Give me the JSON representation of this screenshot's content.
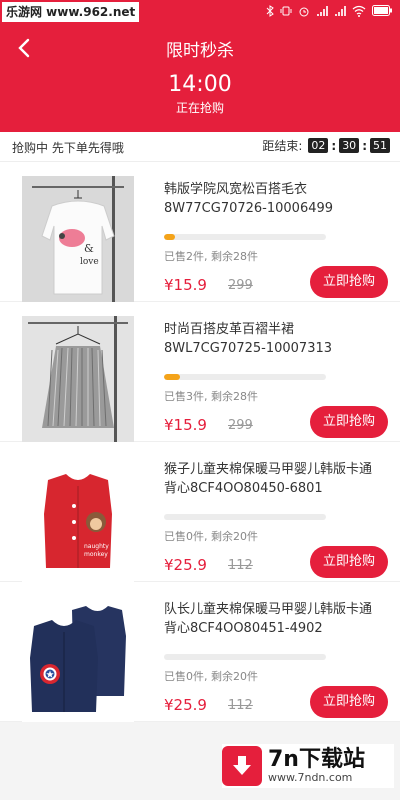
{
  "statusbar": {
    "watermark": "乐游网 www.962.net",
    "icons": [
      "bluetooth-icon",
      "vibrate-icon",
      "alarm-icon",
      "signal-icon",
      "signal-icon",
      "wifi-icon",
      "battery-icon"
    ]
  },
  "header": {
    "title": "限时秒杀",
    "time": "14:00",
    "status": "正在抢购",
    "bg_color": "#e51f3c"
  },
  "infobar": {
    "left_text": "抢购中 先下单先得哦",
    "countdown_label": "距结束:",
    "hours": "02",
    "minutes": "30",
    "seconds": "51"
  },
  "products": [
    {
      "name": "韩版学院风宽松百搭毛衣8W77CG70726-10006499",
      "sold_text": "已售2件, 剩余28件",
      "progress": 0.07,
      "price": "¥15.9",
      "old_price": "299",
      "button": "立即抢购",
      "image": "white-sweater-image"
    },
    {
      "name": "时尚百搭皮革百褶半裙8WL7CG70725-10007313",
      "sold_text": "已售3件, 剩余28件",
      "progress": 0.1,
      "price": "¥15.9",
      "old_price": "299",
      "button": "立即抢购",
      "image": "pleated-skirt-image"
    },
    {
      "name": "猴子儿童夹棉保暖马甲婴儿韩版卡通背心8CF4OO80450-6801",
      "sold_text": "已售0件, 剩余20件",
      "progress": 0,
      "price": "¥25.9",
      "old_price": "112",
      "button": "立即抢购",
      "image": "red-kids-vest-image"
    },
    {
      "name": "队长儿童夹棉保暖马甲婴儿韩版卡通背心8CF4OO80451-4902",
      "sold_text": "已售0件, 剩余20件",
      "progress": 0,
      "price": "¥25.9",
      "old_price": "112",
      "button": "立即抢购",
      "image": "navy-kids-vest-image"
    }
  ],
  "watermark_bottom": {
    "title": "7n下载站",
    "url": "www.7ndn.com"
  },
  "colors": {
    "accent": "#e51f3c",
    "progress": "#f4a31a"
  }
}
